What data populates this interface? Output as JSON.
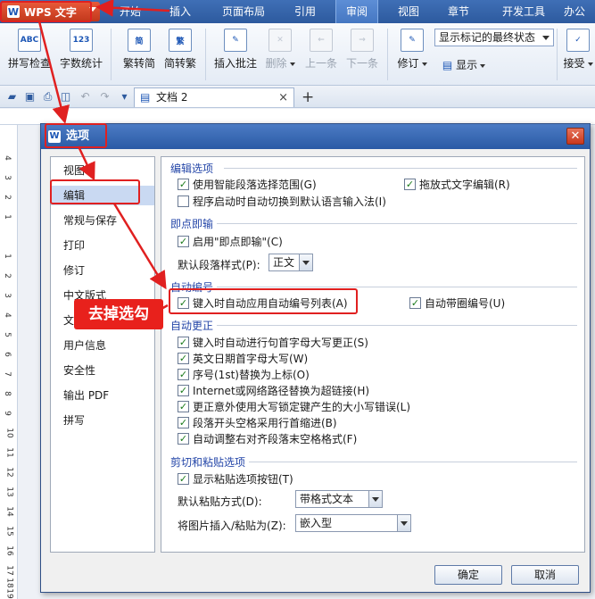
{
  "app": {
    "menu_button": "WPS 文字",
    "menu_tabs": [
      "开始",
      "插入",
      "页面布局",
      "引用",
      "审阅",
      "视图",
      "章节",
      "开发工具",
      "办公"
    ],
    "active_tab": "审阅"
  },
  "ribbon": {
    "spell_check": "拼写检查",
    "word_count": "字数统计",
    "trad_to_simp": "繁转简",
    "simp_to_trad": "简转繁",
    "insert_comment": "插入批注",
    "delete": "删除",
    "prev": "上一条",
    "next": "下一条",
    "revise": "修订",
    "display": "显示",
    "accept": "接受",
    "markup_select": "显示标记的最终状态"
  },
  "doc_tabs": {
    "doc_name": "文档 2",
    "close_symbol": "×",
    "plus_symbol": "+"
  },
  "ruler": {
    "vertical_numbers": [
      "4",
      "3",
      "2",
      "1",
      "1",
      "2",
      "3",
      "4",
      "5",
      "6",
      "7",
      "8",
      "9",
      "10",
      "11",
      "12",
      "13",
      "14",
      "15",
      "16",
      "17",
      "18",
      "19"
    ]
  },
  "dialog": {
    "title": "选项",
    "close_symbol": "✕",
    "side_items": [
      "视图",
      "编辑",
      "常规与保存",
      "打印",
      "修订",
      "中文版式",
      "文件位置",
      "用户信息",
      "安全性",
      "输出 PDF",
      "拼写"
    ],
    "selected_side_item": "编辑",
    "sections": {
      "edit": "编辑选项",
      "click_input": "即点即输",
      "auto_number": "自动编号",
      "auto_correct": "自动更正",
      "cut_paste": "剪切和粘贴选项"
    },
    "edit_options": {
      "smart_paragraph": "使用智能段落选择范围(G)",
      "drag_drop": "拖放式文字编辑(R)",
      "auto_ime": "程序启动时自动切换到默认语言输入法(I)"
    },
    "click_input": {
      "enable": "启用\"即点即输\"(C)",
      "default_style_label": "默认段落样式(P):",
      "default_style_value": "正文"
    },
    "auto_number": {
      "list": "键入时自动应用自动编号列表(A)",
      "circled": "自动带圈编号(U)"
    },
    "auto_correct": [
      "键入时自动进行句首字母大写更正(S)",
      "英文日期首字母大写(W)",
      "序号(1st)替换为上标(O)",
      "Internet或网络路径替换为超链接(H)",
      "更正意外使用大写锁定键产生的大小写错误(L)",
      "段落开头空格采用行首缩进(B)",
      "自动调整右对齐段落末空格格式(F)"
    ],
    "cut_paste": {
      "show_button": "显示粘贴选项按钮(T)",
      "default_paste_label": "默认粘贴方式(D):",
      "default_paste_value": "带格式文本",
      "insert_picture_label": "将图片插入/粘贴为(Z):",
      "insert_picture_value": "嵌入型"
    },
    "ok": "确定",
    "cancel": "取消"
  },
  "annotation": {
    "callout": "去掉选勾",
    "color": "#e02020"
  },
  "check_mark": "✓"
}
